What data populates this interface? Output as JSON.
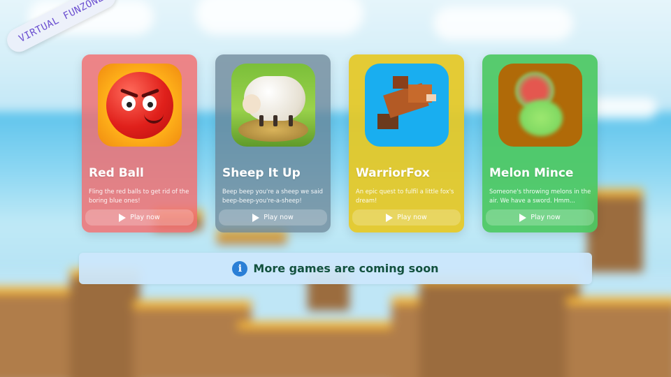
{
  "badge": {
    "text": "VIRTUAL FUNZONE"
  },
  "cards": [
    {
      "title": "Red Ball",
      "description": "Fling the red balls to get rid of the boring blue ones!",
      "play_label": "Play now",
      "color": "#f26c6e",
      "thumbnail": "red-ball-thumbnail"
    },
    {
      "title": "Sheep It Up",
      "description": "Beep beep you're a sheep we said beep-beep-you're-a-sheep!",
      "play_label": "Play now",
      "color": "#677f92",
      "thumbnail": "sheep-thumbnail"
    },
    {
      "title": "WarriorFox",
      "description": "An epic quest to fulfil a little fox's dream!",
      "play_label": "Play now",
      "color": "#e5c826",
      "thumbnail": "fox-thumbnail"
    },
    {
      "title": "Melon Mince",
      "description": "Someone's throwing melons in the air. We have a sword. Hmm...",
      "play_label": "Play now",
      "color": "#4cc862",
      "thumbnail": "melon-thumbnail"
    }
  ],
  "notice": {
    "icon": "info-icon",
    "icon_glyph": "i",
    "text": "More games are coming soon"
  },
  "colors": {
    "notice_bg": "#cce7fc",
    "notice_text": "#12513e",
    "info_icon": "#2a7fd6",
    "badge_text": "#6b4fd0"
  }
}
